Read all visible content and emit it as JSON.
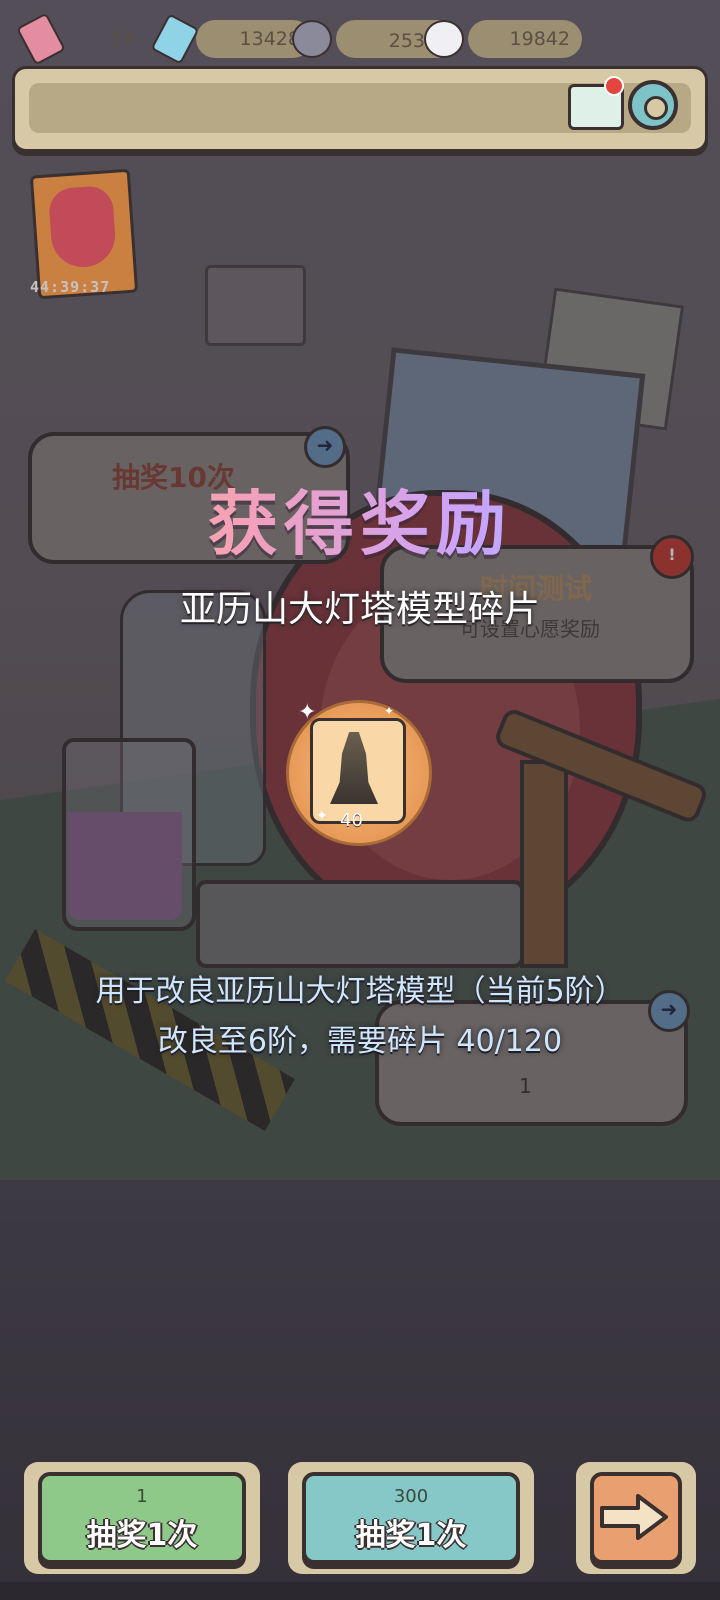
{
  "topbar": {
    "tickets": "24",
    "blue_tickets": "13428",
    "gray_bubbles": "253万",
    "white_bubbles": "19842"
  },
  "event": {
    "timer": "44:39:37"
  },
  "panels": {
    "left_title": "抽奖10次",
    "right_title": "时间测试",
    "right_sub": "可设置心愿奖励",
    "right2_count": "1"
  },
  "reward": {
    "title": "获得奖励",
    "item_name": "亚历山大灯塔模型碎片",
    "item_count": "40",
    "description_line1": "用于改良亚历山大灯塔模型（当前5阶）",
    "description_line2": "改良至6阶，需要碎片  40/120"
  },
  "buttons": {
    "draw1_cost": "1",
    "draw1_label": "抽奖1次",
    "draw2_cost": "300",
    "draw2_label": "抽奖1次"
  },
  "icons": {
    "ticket": "ticket-icon",
    "blue_ticket": "blue-ticket-icon",
    "gray_bubble": "gray-bubble-icon",
    "white_bubble": "white-bubble-icon",
    "mail": "mail-icon",
    "settings": "gear-icon",
    "next": "arrow-right-icon"
  },
  "colors": {
    "accent_green": "#8ec98a",
    "accent_teal": "#86c8c8",
    "accent_orange": "#e8a070",
    "frame": "#d8c9a6"
  }
}
